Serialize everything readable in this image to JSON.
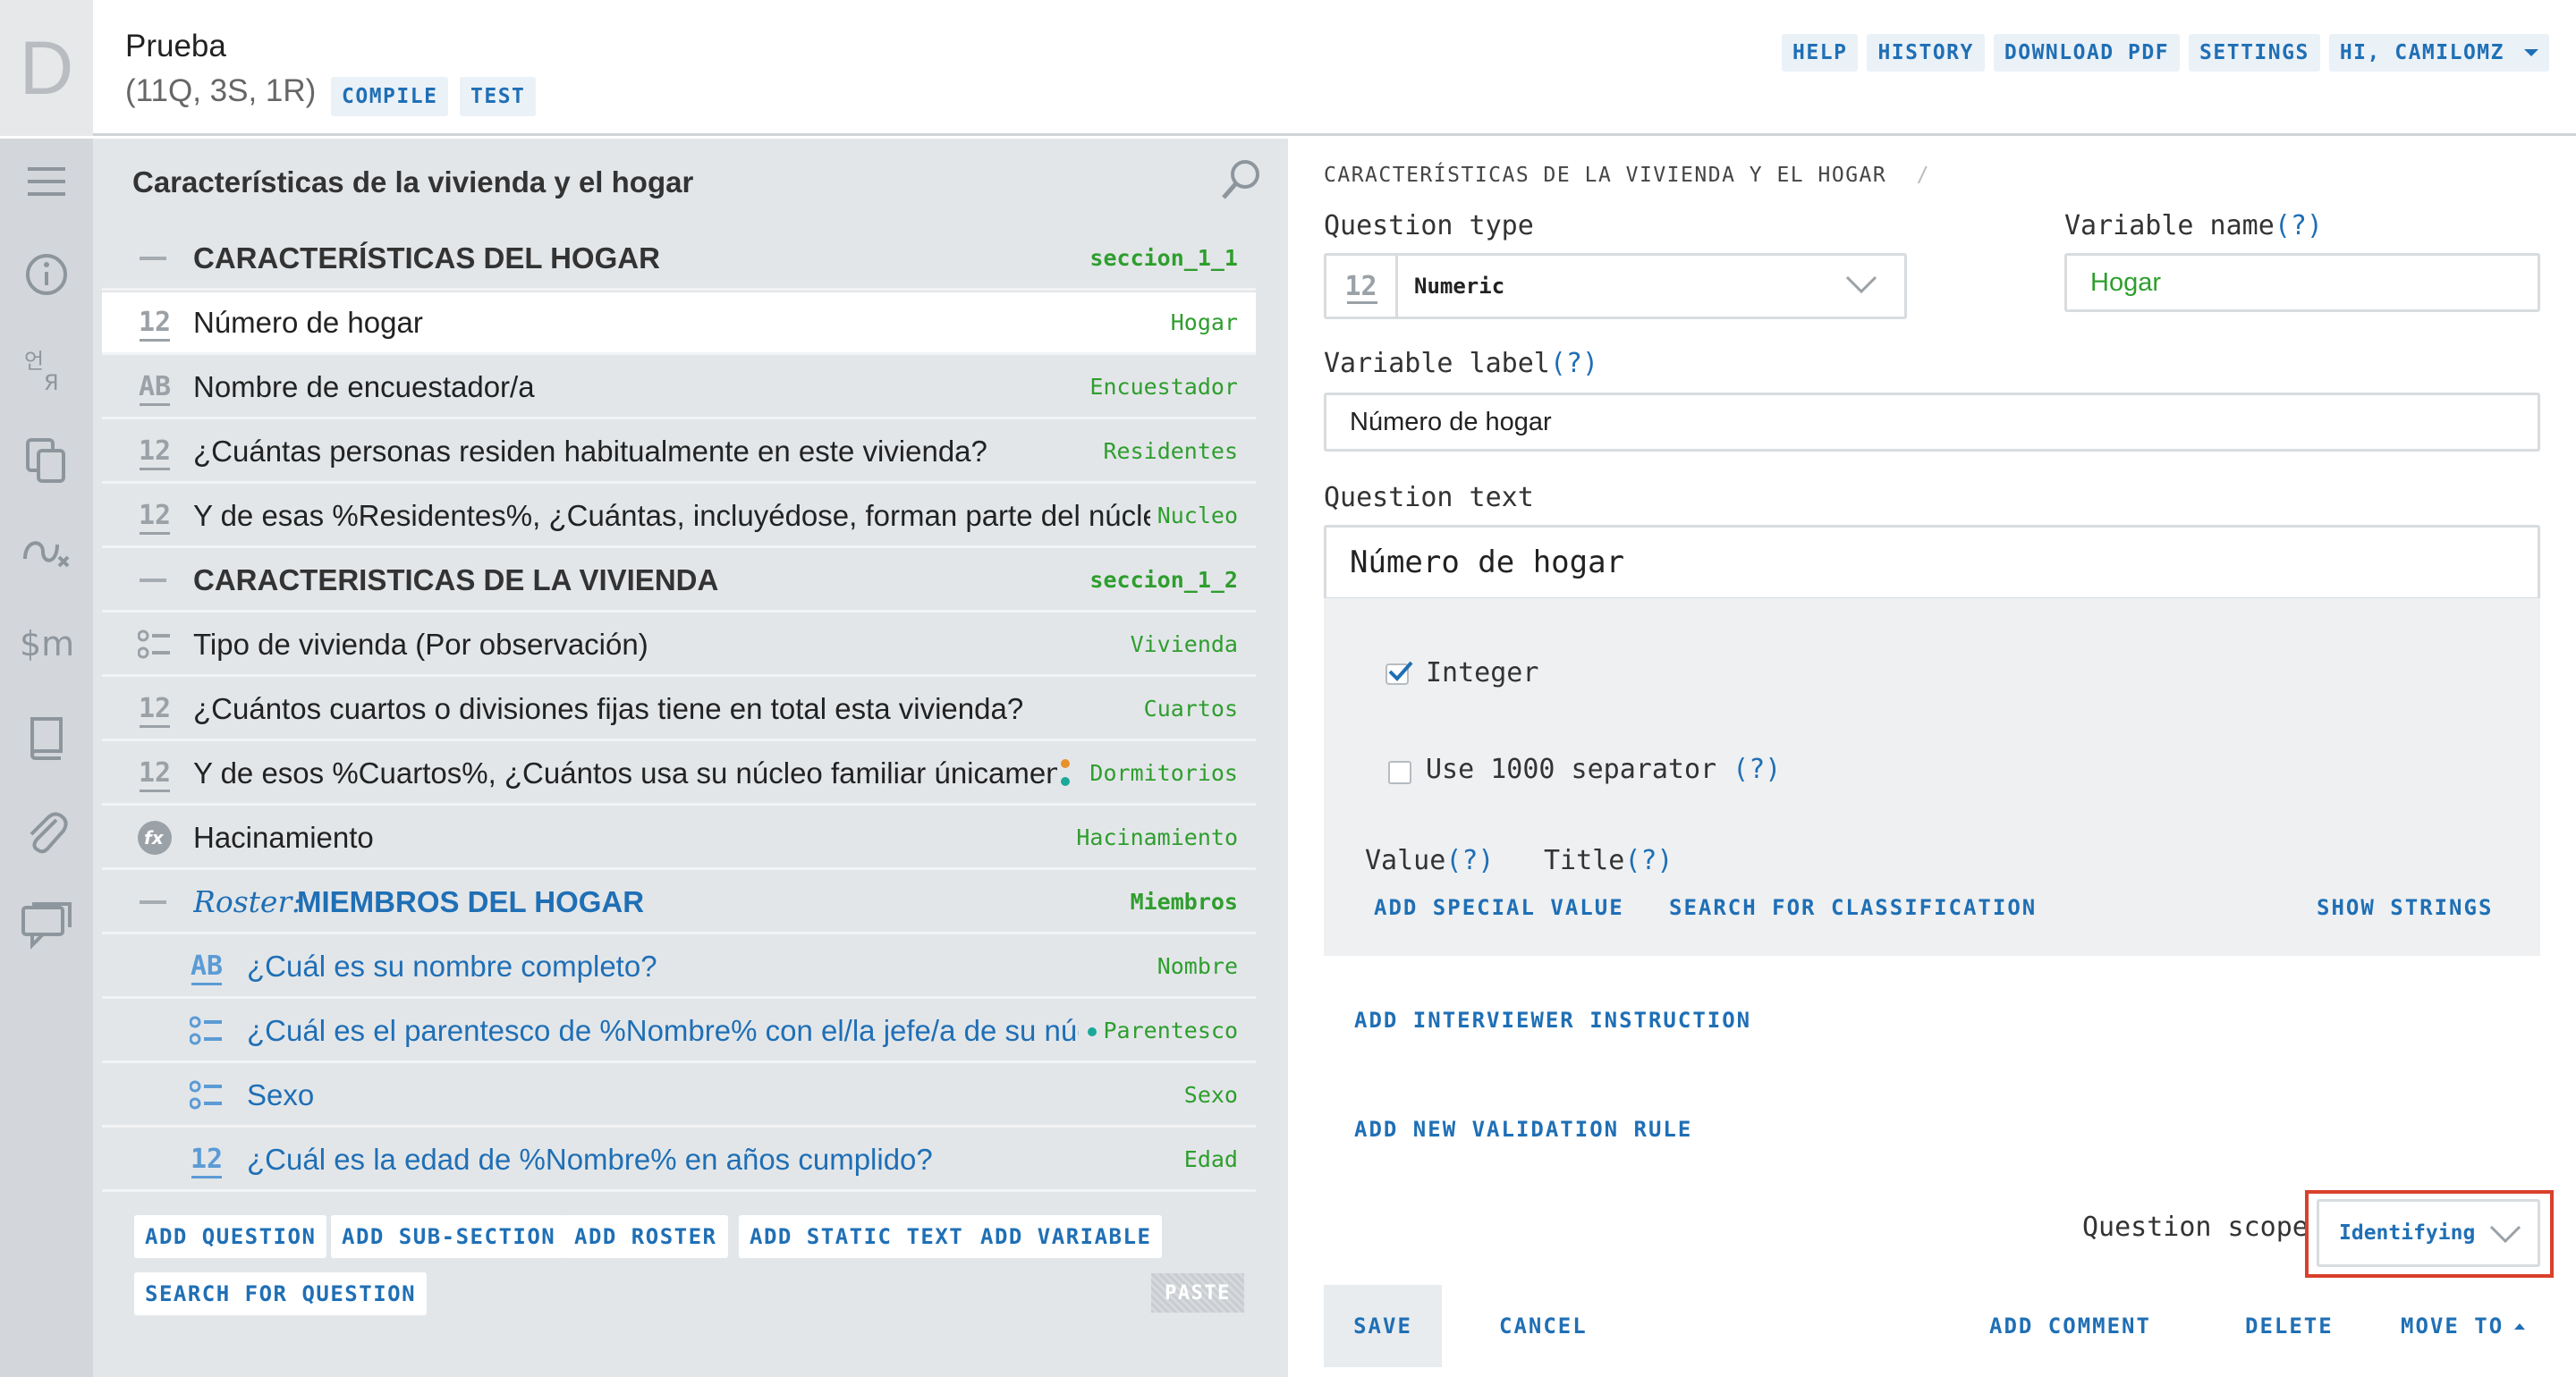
{
  "header": {
    "logo_letter": "D",
    "title": "Prueba",
    "stats": "(11Q, 3S, 1R)",
    "compile": "COMPILE",
    "test": "TEST",
    "nav": [
      "HELP",
      "HISTORY",
      "DOWNLOAD PDF",
      "SETTINGS",
      "HI, CAMILOMZ"
    ]
  },
  "tree": {
    "header": "Características de la vivienda y el hogar",
    "rows": [
      {
        "type": "section",
        "icon": "dash-icon",
        "title": "CARACTERÍSTICAS DEL HOGAR",
        "var": "seccion_1_1"
      },
      {
        "type": "numeric",
        "icon": "12",
        "title": "Número de hogar",
        "var": "Hogar"
      },
      {
        "type": "text",
        "icon": "AB",
        "title": "Nombre de encuestador/a",
        "var": "Encuestador"
      },
      {
        "type": "numeric",
        "icon": "12",
        "title": "¿Cuántas personas residen habitualmente en este vivienda?",
        "var": "Residentes"
      },
      {
        "type": "numeric",
        "icon": "12",
        "title": "Y de esas %Residentes%, ¿Cuántas, incluyédose, forman parte del núcleo",
        "var": "Nucleo"
      },
      {
        "type": "section",
        "icon": "dash-icon",
        "title": "CARACTERISTICAS DE LA VIVIENDA",
        "var": "seccion_1_2"
      },
      {
        "type": "list",
        "icon": "list",
        "title": "Tipo de vivienda (Por observación)",
        "var": "Vivienda"
      },
      {
        "type": "numeric",
        "icon": "12",
        "title": "¿Cuántos cuartos o divisiones fijas tiene en total esta vivienda?",
        "var": "Cuartos"
      },
      {
        "type": "numeric",
        "icon": "12",
        "title": "Y de esos %Cuartos%, ¿Cuántos usa su núcleo familiar únicamente",
        "var": "Dormitorios"
      },
      {
        "type": "variable",
        "icon": "fx",
        "title": "Hacinamiento",
        "var": "Hacinamiento"
      },
      {
        "type": "roster",
        "icon": "dash-icon",
        "roster_prefix": "Roster:",
        "title": "MIEMBROS DEL HOGAR",
        "var": "Miembros"
      },
      {
        "type": "text",
        "icon": "AB",
        "title": "¿Cuál es su nombre completo?",
        "var": "Nombre"
      },
      {
        "type": "list",
        "icon": "list",
        "title": "¿Cuál es el parentesco de %Nombre% con el/la jefe/a de su núcl",
        "var": "Parentesco"
      },
      {
        "type": "list",
        "icon": "list",
        "title": "Sexo",
        "var": "Sexo"
      },
      {
        "type": "numeric",
        "icon": "12",
        "title": "¿Cuál es la edad de %Nombre% en años cumplido?",
        "var": "Edad"
      }
    ],
    "buttons": [
      "ADD QUESTION",
      "ADD SUB-SECTION",
      "ADD ROSTER",
      "ADD STATIC TEXT",
      "ADD VARIABLE"
    ],
    "search_button": "SEARCH FOR QUESTION",
    "paste": "PASTE"
  },
  "editor": {
    "breadcrumb": "CARACTERÍSTICAS DE LA VIVIENDA Y EL HOGAR",
    "breadcrumb_sep": "/",
    "question_type_label": "Question type",
    "question_type_icon": "12",
    "question_type_value": "Numeric",
    "variable_name_label": "Variable name",
    "variable_name_value": "Hogar",
    "variable_label_label": "Variable label",
    "variable_label_value": "Número de hogar",
    "question_text_label": "Question text",
    "question_text_value": "Número de hogar",
    "help_mark": "(?)",
    "integer_label": "Integer",
    "separator_label": "Use 1000 separator",
    "value_header": "Value",
    "title_header": "Title",
    "add_special_value": "ADD SPECIAL VALUE",
    "search_classification": "SEARCH FOR CLASSIFICATION",
    "show_strings": "SHOW STRINGS",
    "add_instruction": "ADD INTERVIEWER INSTRUCTION",
    "add_validation": "ADD NEW VALIDATION RULE",
    "scope_label": "Question scope",
    "scope_value": "Identifying",
    "save": "SAVE",
    "cancel": "CANCEL",
    "add_comment": "ADD COMMENT",
    "delete": "DELETE",
    "move_to": "MOVE TO"
  },
  "colors": {
    "accent": "#1f6fb5",
    "var_green": "#2e9e2e",
    "highlight_red": "#d9402b",
    "dot_orange": "#e8902a",
    "dot_teal": "#1aa89a"
  }
}
